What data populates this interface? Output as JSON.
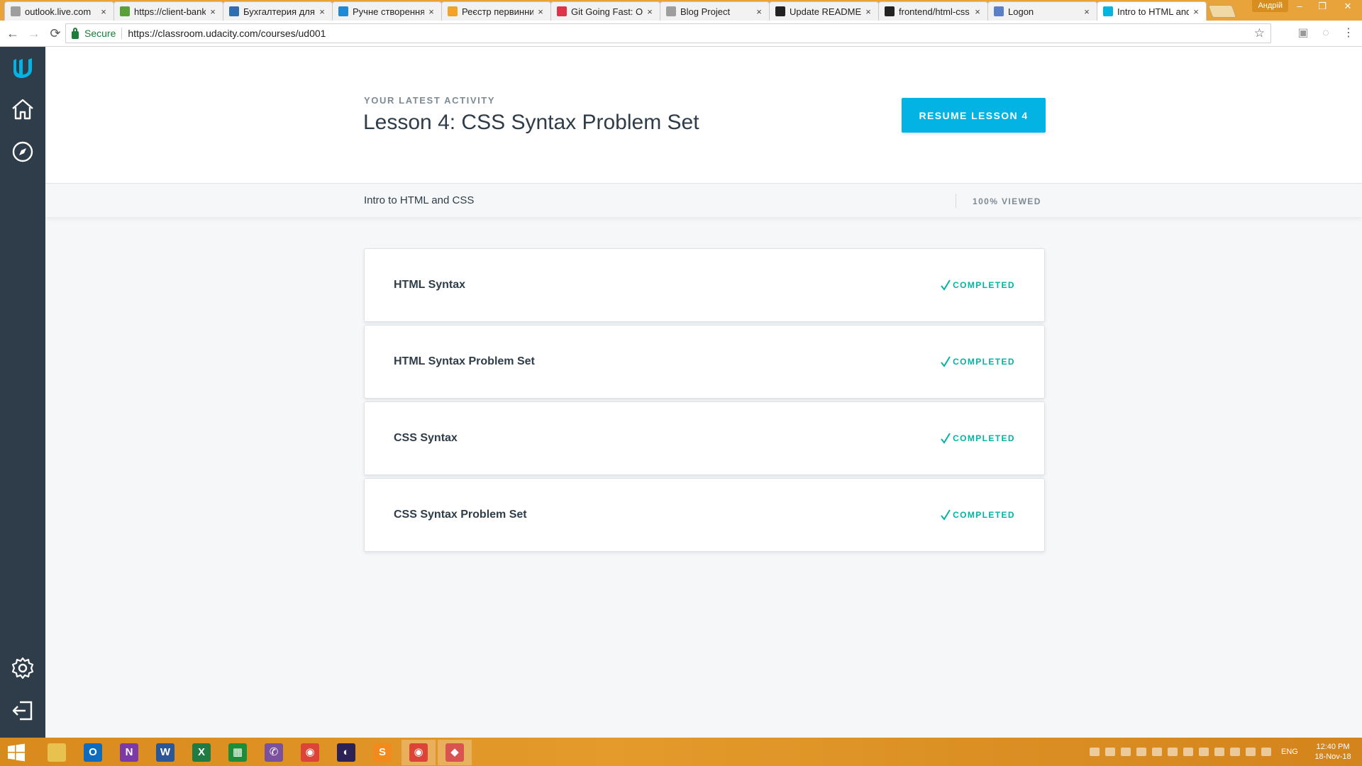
{
  "browser": {
    "tabs": [
      {
        "label": "outlook.live.com",
        "favicon_color": "#9e9e9e",
        "active": false
      },
      {
        "label": "https://client-bank",
        "favicon_color": "#5aa03a",
        "active": false
      },
      {
        "label": "Бухгалтерия для",
        "favicon_color": "#2f6db5",
        "active": false
      },
      {
        "label": "Ручне створення",
        "favicon_color": "#1f8ad8",
        "active": false
      },
      {
        "label": "Реєстр первинних",
        "favicon_color": "#f3a51f",
        "active": false
      },
      {
        "label": "Git Going Fast: On",
        "favicon_color": "#e0334a",
        "active": false
      },
      {
        "label": "Blog Project",
        "favicon_color": "#9e9e9e",
        "active": false
      },
      {
        "label": "Update README",
        "favicon_color": "#222222",
        "active": false
      },
      {
        "label": "frontend/html-css",
        "favicon_color": "#222222",
        "active": false
      },
      {
        "label": "Logon",
        "favicon_color": "#5b7fc4",
        "active": false
      },
      {
        "label": "Intro to HTML and",
        "favicon_color": "#02b3e4",
        "active": true
      }
    ],
    "profile_name": "Андрій",
    "close_glyph": "×",
    "security_label": "Secure",
    "url": "https://classroom.udacity.com/courses/ud001"
  },
  "sidebar": {
    "icons": [
      "udacity-logo-icon",
      "home-icon",
      "compass-icon",
      "gear-icon",
      "logout-icon"
    ]
  },
  "activity": {
    "kicker": "YOUR LATEST ACTIVITY",
    "title": "Lesson 4: CSS Syntax Problem Set",
    "resume_label": "RESUME LESSON 4"
  },
  "course": {
    "name": "Intro to HTML and CSS",
    "progress_label": "100% VIEWED",
    "progress": 1.0
  },
  "lessons": [
    {
      "title": "HTML Syntax",
      "status": "COMPLETED"
    },
    {
      "title": "HTML Syntax Problem Set",
      "status": "COMPLETED"
    },
    {
      "title": "CSS Syntax",
      "status": "COMPLETED"
    },
    {
      "title": "CSS Syntax Problem Set",
      "status": "COMPLETED"
    }
  ],
  "colors": {
    "accent": "#02b3e4",
    "sidebar": "#2e3d49",
    "completed": "#15c26b",
    "taskbar": "#e49b2b"
  },
  "taskbar": {
    "apps": [
      {
        "name": "file-explorer",
        "color": "#e8c24f",
        "glyph": ""
      },
      {
        "name": "outlook",
        "color": "#0f6cbd",
        "glyph": "O"
      },
      {
        "name": "onenote",
        "color": "#7b3aa6",
        "glyph": "N"
      },
      {
        "name": "word",
        "color": "#2b5797",
        "glyph": "W"
      },
      {
        "name": "excel",
        "color": "#1f7a43",
        "glyph": "X"
      },
      {
        "name": "calculator-sheet",
        "color": "#1e8d3a",
        "glyph": "▦"
      },
      {
        "name": "viber",
        "color": "#7b519d",
        "glyph": "✆"
      },
      {
        "name": "chrome",
        "color": "#db4437",
        "glyph": "◉"
      },
      {
        "name": "eclipse",
        "color": "#2c2255",
        "glyph": "◐"
      },
      {
        "name": "sublime",
        "color": "#f38a1d",
        "glyph": "S"
      },
      {
        "name": "chrome-active",
        "color": "#db4437",
        "glyph": "◉"
      },
      {
        "name": "git-gui",
        "color": "#d9534f",
        "glyph": "◆"
      }
    ],
    "language": "ENG",
    "time": "12:40 PM",
    "date": "18-Nov-18"
  }
}
